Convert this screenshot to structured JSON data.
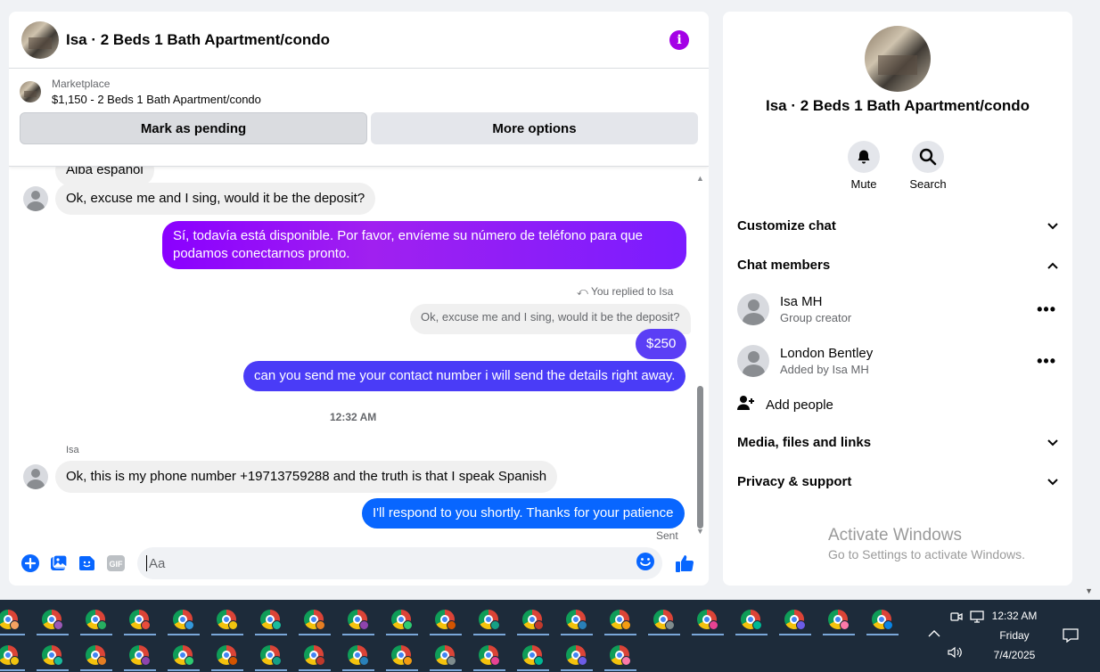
{
  "chat": {
    "title": "Isa · 2 Beds 1 Bath Apartment/condo",
    "marketplace_label": "Marketplace",
    "listing": "$1,150 - 2 Beds 1 Bath Apartment/condo",
    "mark_pending": "Mark as pending",
    "more_options": "More options",
    "messages": {
      "cut_top": "Alba español",
      "m1": "Ok, excuse me and I sing, would it be the deposit?",
      "m2": "Sí, todavía está disponible. Por favor, envíeme su número de teléfono para que podamos conectarnos pronto.",
      "reply_note": "You replied to Isa",
      "reply_quote": "Ok, excuse me and I sing, would it be the deposit?",
      "m3": "$250",
      "m4": "can you send me your contact number i will send the details right away.",
      "timestamp": "12:32 AM",
      "sender": "Isa",
      "m5": "Ok, this is my phone number +19713759288 and the truth is that I speak Spanish",
      "m6": "I'll respond to you shortly. Thanks for your patience",
      "status": "Sent"
    },
    "composer_placeholder": "Aa"
  },
  "info": {
    "title": "Isa · 2 Beds 1 Bath Apartment/condo",
    "mute": "Mute",
    "search": "Search",
    "customize": "Customize chat",
    "members_header": "Chat members",
    "members": [
      {
        "name": "Isa MH",
        "sub": "Group creator"
      },
      {
        "name": "London Bentley",
        "sub": "Added by Isa MH"
      }
    ],
    "add_people": "Add people",
    "media": "Media, files and links",
    "privacy": "Privacy & support",
    "activate_title": "Activate Windows",
    "activate_sub": "Go to Settings to activate Windows."
  },
  "taskbar": {
    "time": "12:32 AM",
    "day": "Friday",
    "date": "7/4/2025"
  },
  "colors": {
    "accent": "#0866ff",
    "purple": "#a400e6",
    "gradient_purple": "#8a00ff",
    "gradient_blue": "#4a3cf7"
  }
}
